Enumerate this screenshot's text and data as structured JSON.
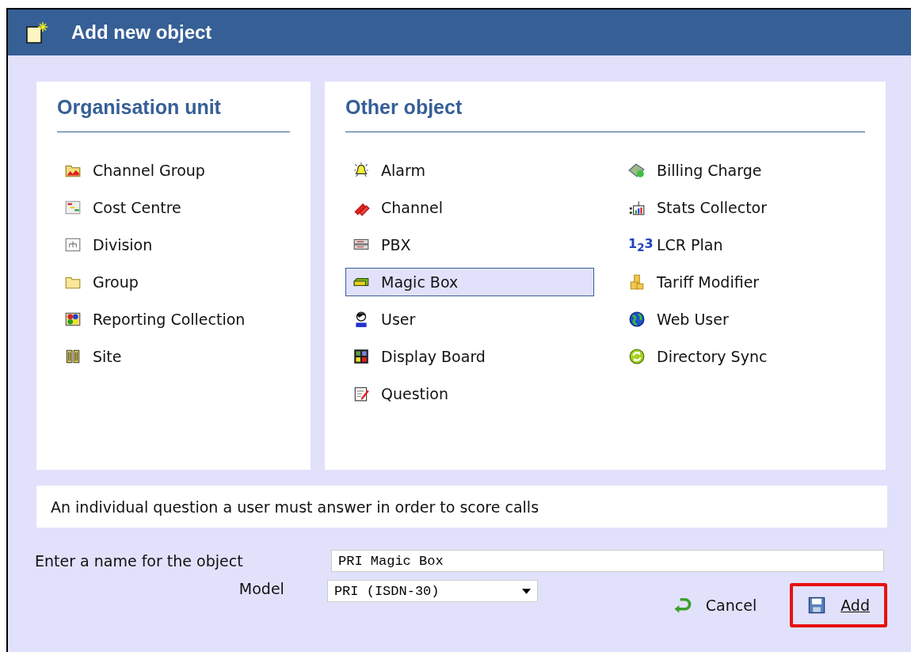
{
  "window": {
    "title": "Add new object"
  },
  "organisation_unit": {
    "heading": "Organisation unit",
    "items": [
      {
        "label": "Channel Group",
        "selected": false
      },
      {
        "label": "Cost Centre",
        "selected": false
      },
      {
        "label": "Division",
        "selected": false
      },
      {
        "label": "Group",
        "selected": false
      },
      {
        "label": "Reporting Collection",
        "selected": false
      },
      {
        "label": "Site",
        "selected": false
      }
    ]
  },
  "other_object": {
    "heading": "Other object",
    "columns": [
      {
        "items": [
          {
            "label": "Alarm",
            "selected": false
          },
          {
            "label": "Channel",
            "selected": false
          },
          {
            "label": "PBX",
            "selected": false
          },
          {
            "label": "Magic Box",
            "selected": true
          },
          {
            "label": "User",
            "selected": false
          },
          {
            "label": "Display Board",
            "selected": false
          },
          {
            "label": "Question",
            "selected": false
          }
        ]
      },
      {
        "items": [
          {
            "label": "Billing Charge",
            "selected": false
          },
          {
            "label": "Stats Collector",
            "selected": false
          },
          {
            "label": "LCR Plan",
            "selected": false,
            "icon_glyph": "1$_{2}$3"
          },
          {
            "label": "Tariff Modifier",
            "selected": false
          },
          {
            "label": "Web User",
            "selected": false
          },
          {
            "label": "Directory Sync",
            "selected": false
          }
        ]
      }
    ]
  },
  "description": "An individual question a user must answer in order to score calls",
  "name_field": {
    "label": "Enter a name for the object",
    "value": "PRI Magic Box"
  },
  "model_field": {
    "label": "Model",
    "value": "PRI (ISDN-30)"
  },
  "buttons": [
    {
      "label": "Cancel",
      "kind": "cancel",
      "highlighted": false
    },
    {
      "label": "Add",
      "kind": "add",
      "highlighted": true
    }
  ]
}
